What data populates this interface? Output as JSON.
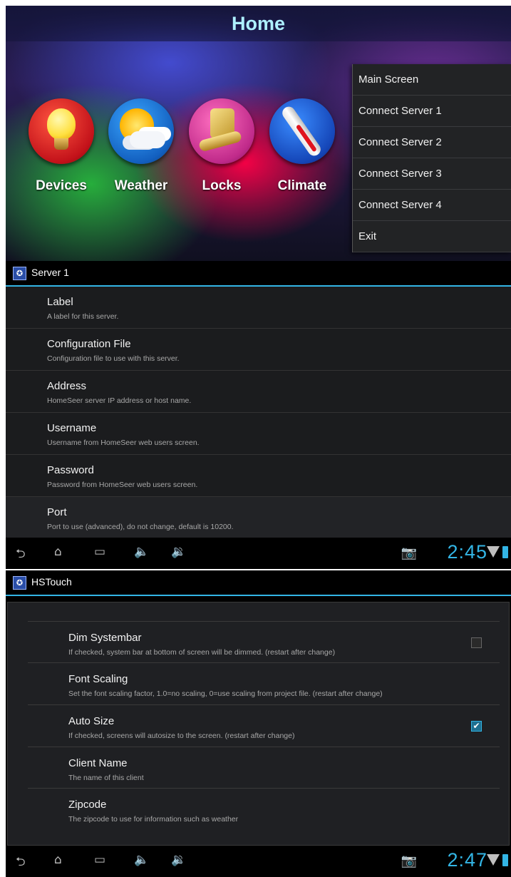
{
  "home": {
    "title": "Home",
    "tiles": [
      {
        "label": "Devices",
        "icon": "lightbulb-icon"
      },
      {
        "label": "Weather",
        "icon": "weather-icon"
      },
      {
        "label": "Locks",
        "icon": "lock-icon"
      },
      {
        "label": "Climate",
        "icon": "thermometer-icon"
      }
    ],
    "menu": [
      "Main Screen",
      "Connect Server 1",
      "Connect Server 2",
      "Connect Server 3",
      "Connect Server 4",
      "Exit"
    ]
  },
  "server": {
    "title": "Server 1",
    "prefs": [
      {
        "title": "Label",
        "summary": "A label for this server."
      },
      {
        "title": "Configuration File",
        "summary": "Configuration file to use with this server."
      },
      {
        "title": "Address",
        "summary": "HomeSeer server IP address or host name."
      },
      {
        "title": "Username",
        "summary": "Username from HomeSeer web users screen."
      },
      {
        "title": "Password",
        "summary": "Password from HomeSeer web users screen."
      },
      {
        "title": "Port",
        "summary": "Port to use (advanced), do not change, default is 10200."
      }
    ],
    "clock": "2:45"
  },
  "hstouch": {
    "title": "HSTouch",
    "prefs": [
      {
        "title": "Dim Systembar",
        "summary": "If checked, system bar at bottom of screen will be dimmed. (restart after change)",
        "checked": false
      },
      {
        "title": "Font Scaling",
        "summary": "Set the font scaling factor, 1.0=no scaling, 0=use scaling from project file. (restart after change)"
      },
      {
        "title": "Auto Size",
        "summary": "If checked, screens will autosize to the screen. (restart after change)",
        "checked": true
      },
      {
        "title": "Client Name",
        "summary": "The name of this client"
      },
      {
        "title": "Zipcode",
        "summary": "The zipcode to use for information such as weather"
      }
    ],
    "clock": "2:47"
  },
  "colors": {
    "accent": "#33b5e5",
    "background": "#1b1c1e"
  }
}
